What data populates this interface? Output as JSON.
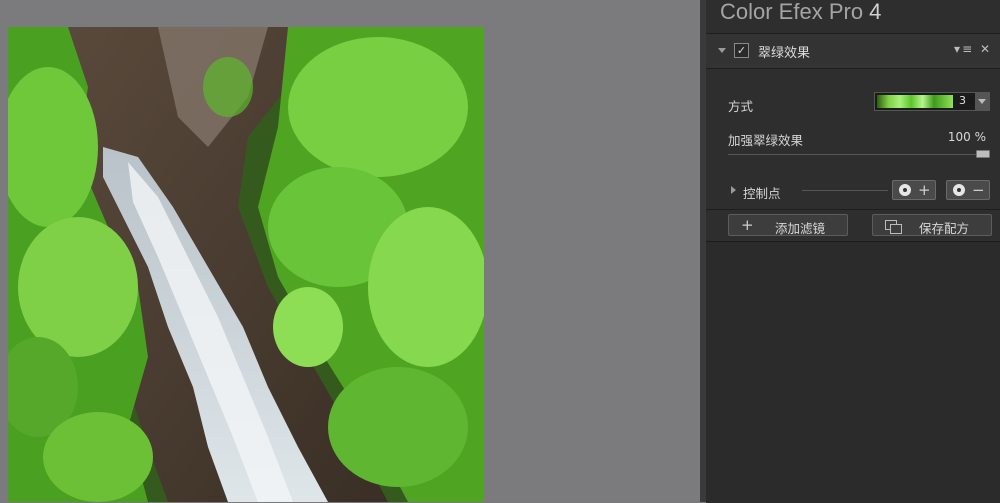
{
  "app": {
    "name": "Color Efex Pro",
    "version": "4"
  },
  "filter": {
    "name": "翠绿效果",
    "enabled_mark": "✓",
    "header_icons": "▾≡ ✕"
  },
  "params": {
    "method_label": "方式",
    "method_value": "3",
    "strength_label": "加强翠绿效果",
    "strength_value": "100 %",
    "strength_fraction": 1.0
  },
  "control_points": {
    "label": "控制点",
    "add_sign": "+",
    "remove_sign": "−"
  },
  "actions": {
    "add_filter_icon": "+",
    "add_filter_label": "添加滤镜",
    "save_recipe_label": "保存配方"
  },
  "colors": {
    "panel_bg": "#2e2e2e",
    "canvas_bg": "#7a797b",
    "foliage": "#5cc42a"
  }
}
